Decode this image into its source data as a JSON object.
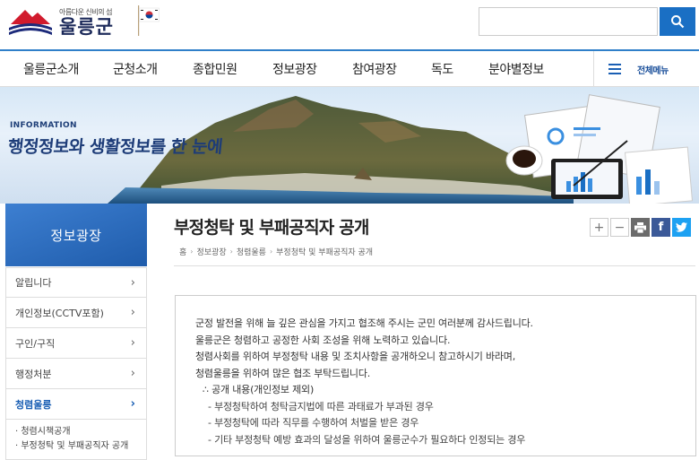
{
  "header": {
    "logo_subtitle": "아름다운 신비의 섬",
    "logo_name": "울릉군",
    "search_placeholder": ""
  },
  "gnb": {
    "items": [
      "울릉군소개",
      "군청소개",
      "종합민원",
      "정보광장",
      "참여광장",
      "독도",
      "분야별정보"
    ],
    "all_menu": "전체메뉴"
  },
  "banner": {
    "eyebrow": "INFORMATION",
    "title": "행정정보와 생활정보를 한 눈에"
  },
  "lnb": {
    "title": "정보광장",
    "items": [
      {
        "label": "알립니다"
      },
      {
        "label": "개인정보(CCTV포함)"
      },
      {
        "label": "구인/구직"
      },
      {
        "label": "행정처분"
      },
      {
        "label": "청렴울릉"
      }
    ],
    "sub_items": [
      "청렴시책공개",
      "부정청탁 및 부패공직자 공개"
    ]
  },
  "content": {
    "title": "부정청탁 및 부패공직자 공개",
    "breadcrumb": [
      "홈",
      "정보광장",
      "청렴울릉",
      "부정청탁 및 부패공직자 공개"
    ],
    "paragraphs": [
      "군정 발전을 위해 늘 깊은 관심을 가지고 협조해 주시는 군민 여러분께 감사드립니다.",
      "울릉군은 청렴하고 공정한 사회 조성을 위해 노력하고 있습니다.",
      "청렴사회를 위하여 부정청탁 내용 및 조치사항을 공개하오니 참고하시기 바라며,",
      "청렴울릉을 위하여 많은 협조 부탁드립니다."
    ],
    "section_label": "∴ 공개 내용(개인정보 제외)",
    "list": [
      "- 부정청탁하여 청탁금지법에 따른 과태료가 부과된 경우",
      "- 부정청탁에 따라 직무를 수행하여 처벌을 받은 경우",
      "- 기타 부정청탁 예방 효과의 달성을 위하여 울릉군수가 필요하다 인정되는 경우"
    ]
  },
  "colors": {
    "accent": "#1a6fc4",
    "nav_border": "#2f7fc9",
    "lnb_title_bg": "#2a6bbf",
    "facebook": "#3b5998",
    "twitter": "#1da1f2"
  }
}
